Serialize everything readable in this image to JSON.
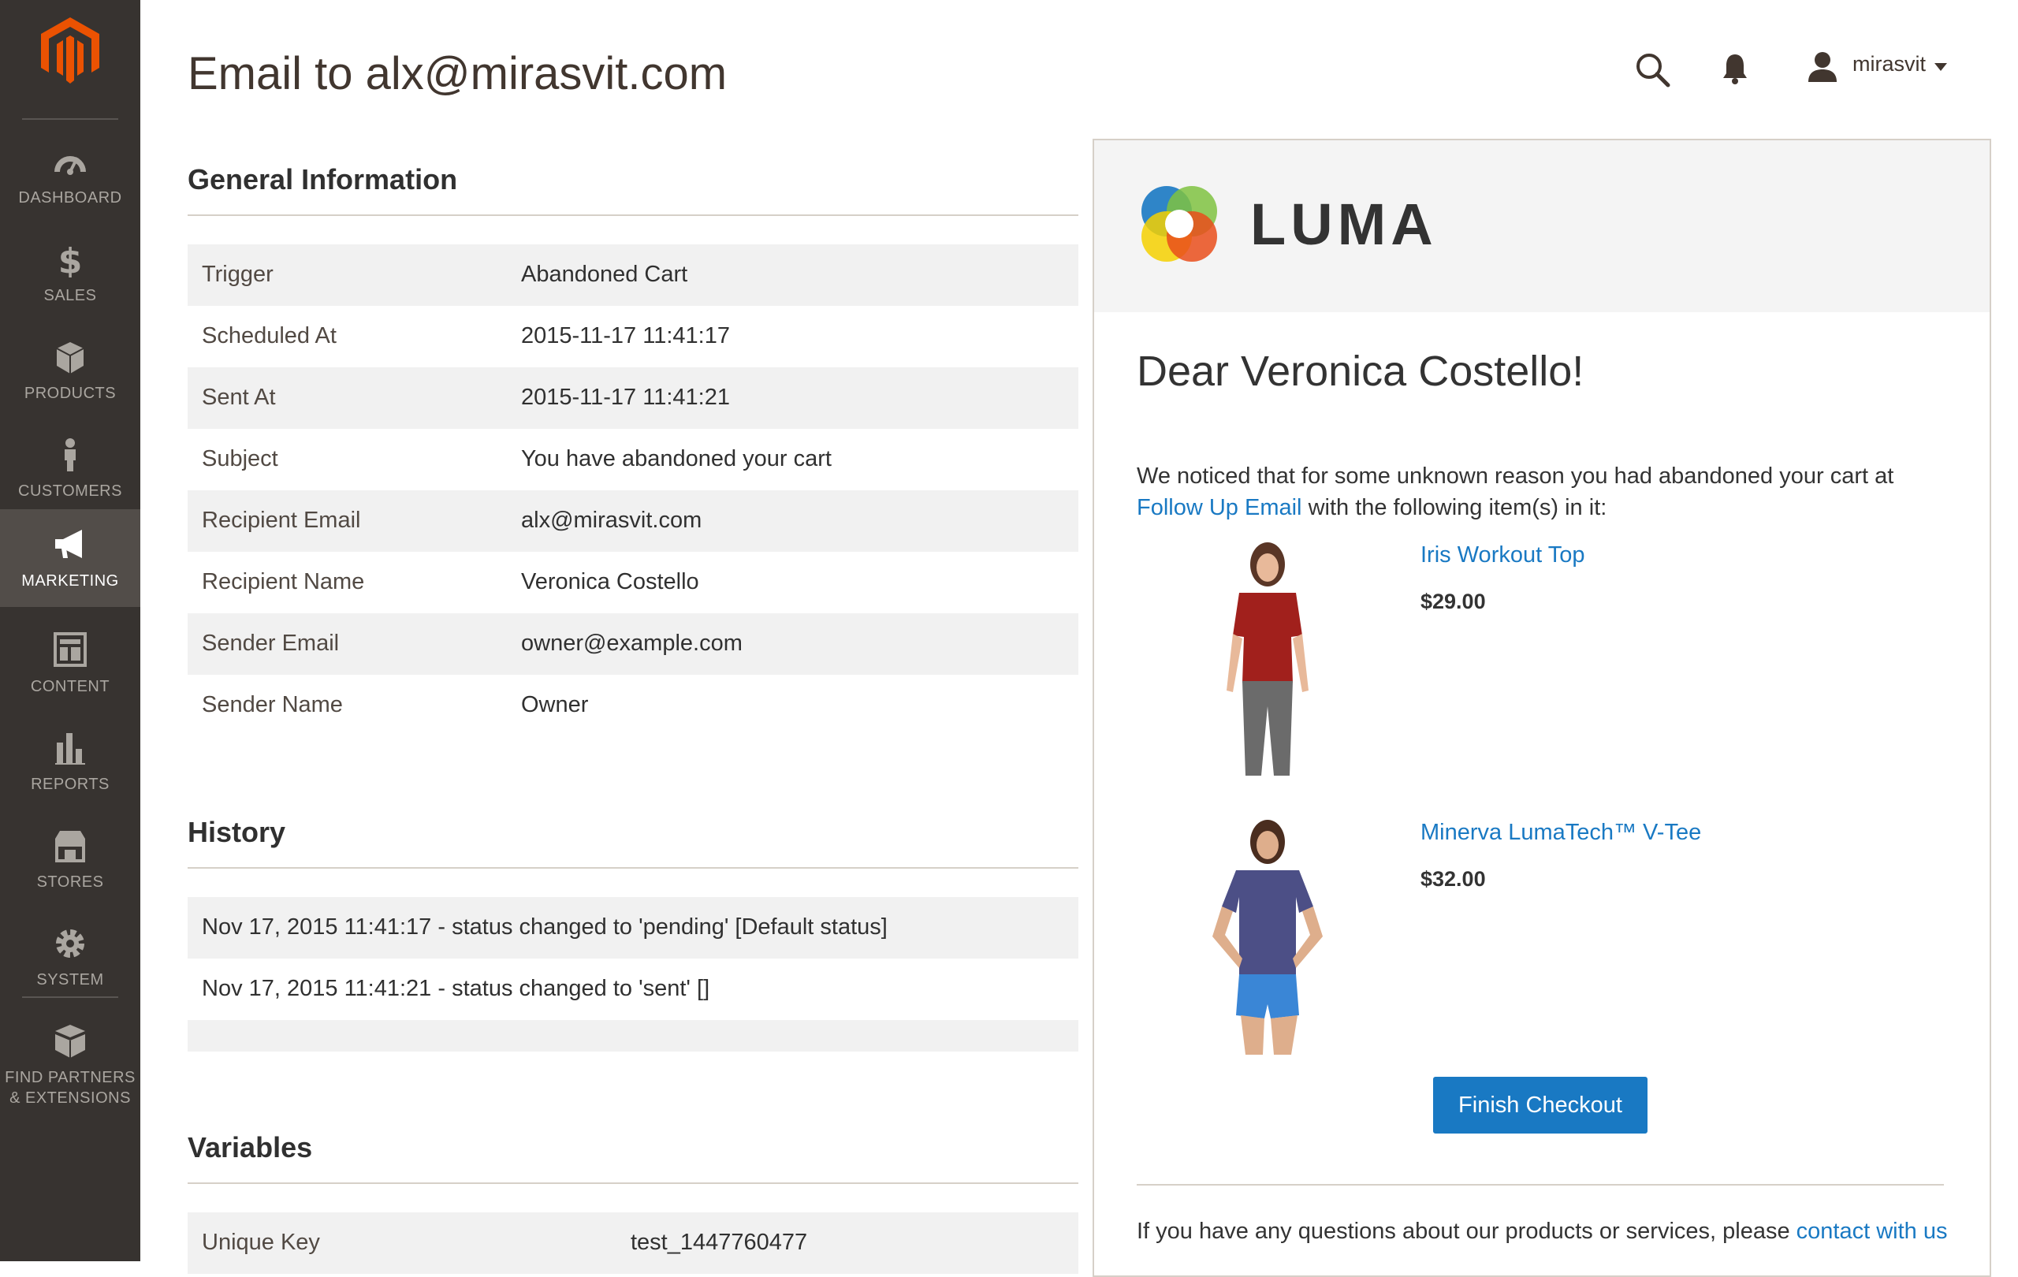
{
  "page": {
    "title": "Email to alx@mirasvit.com"
  },
  "header": {
    "user": "mirasvit"
  },
  "sidebar": {
    "items": [
      {
        "id": "dashboard",
        "label": "DASHBOARD"
      },
      {
        "id": "sales",
        "label": "SALES"
      },
      {
        "id": "products",
        "label": "PRODUCTS"
      },
      {
        "id": "customers",
        "label": "CUSTOMERS"
      },
      {
        "id": "marketing",
        "label": "MARKETING",
        "active": true
      },
      {
        "id": "content",
        "label": "CONTENT"
      },
      {
        "id": "reports",
        "label": "REPORTS"
      },
      {
        "id": "stores",
        "label": "STORES"
      },
      {
        "id": "system",
        "label": "SYSTEM"
      },
      {
        "id": "partners",
        "label_line1": "FIND PARTNERS",
        "label_line2": "& EXTENSIONS"
      }
    ]
  },
  "general": {
    "title": "General Information",
    "rows": [
      {
        "key": "Trigger",
        "value": "Abandoned Cart"
      },
      {
        "key": "Scheduled At",
        "value": "2015-11-17 11:41:17"
      },
      {
        "key": "Sent At",
        "value": "2015-11-17 11:41:21"
      },
      {
        "key": "Subject",
        "value": "You have abandoned your cart"
      },
      {
        "key": "Recipient Email",
        "value": "alx@mirasvit.com"
      },
      {
        "key": "Recipient Name",
        "value": "Veronica Costello"
      },
      {
        "key": "Sender Email",
        "value": "owner@example.com"
      },
      {
        "key": "Sender Name",
        "value": "Owner"
      }
    ]
  },
  "history": {
    "title": "History",
    "rows": [
      "Nov 17, 2015 11:41:17 - status changed to 'pending' [Default status]",
      "Nov 17, 2015 11:41:21 - status changed to 'sent' []"
    ]
  },
  "variables": {
    "title": "Variables",
    "rows": [
      {
        "key": "Unique Key",
        "value": "test_1447760477"
      }
    ]
  },
  "email": {
    "brand": "LUMA",
    "greeting": "Dear Veronica Costello!",
    "intro_text": "We noticed that for some unknown reason you had abandoned your cart at",
    "intro_link": "Follow Up Email",
    "intro_text2": "with the following item(s) in it:",
    "products": [
      {
        "name": "Iris Workout Top",
        "price": "$29.00"
      },
      {
        "name": "Minerva LumaTech™ V-Tee",
        "price": "$32.00"
      }
    ],
    "button": "Finish Checkout",
    "footer_text": "If you have any questions about our products or services, please",
    "footer_link": "contact with us"
  },
  "colors": {
    "sidebar_bg": "#373330",
    "sidebar_active": "#524d49",
    "link": "#1979c3",
    "brand_orange": "#eb5202"
  },
  "icons": {
    "header": [
      "search-icon",
      "bell-icon",
      "user-icon",
      "caret-down-icon"
    ],
    "sidebar": [
      "dashboard-icon",
      "dollar-icon",
      "box-icon",
      "person-icon",
      "megaphone-icon",
      "layout-icon",
      "bar-chart-icon",
      "storefront-icon",
      "gear-icon",
      "blocks-icon"
    ]
  }
}
